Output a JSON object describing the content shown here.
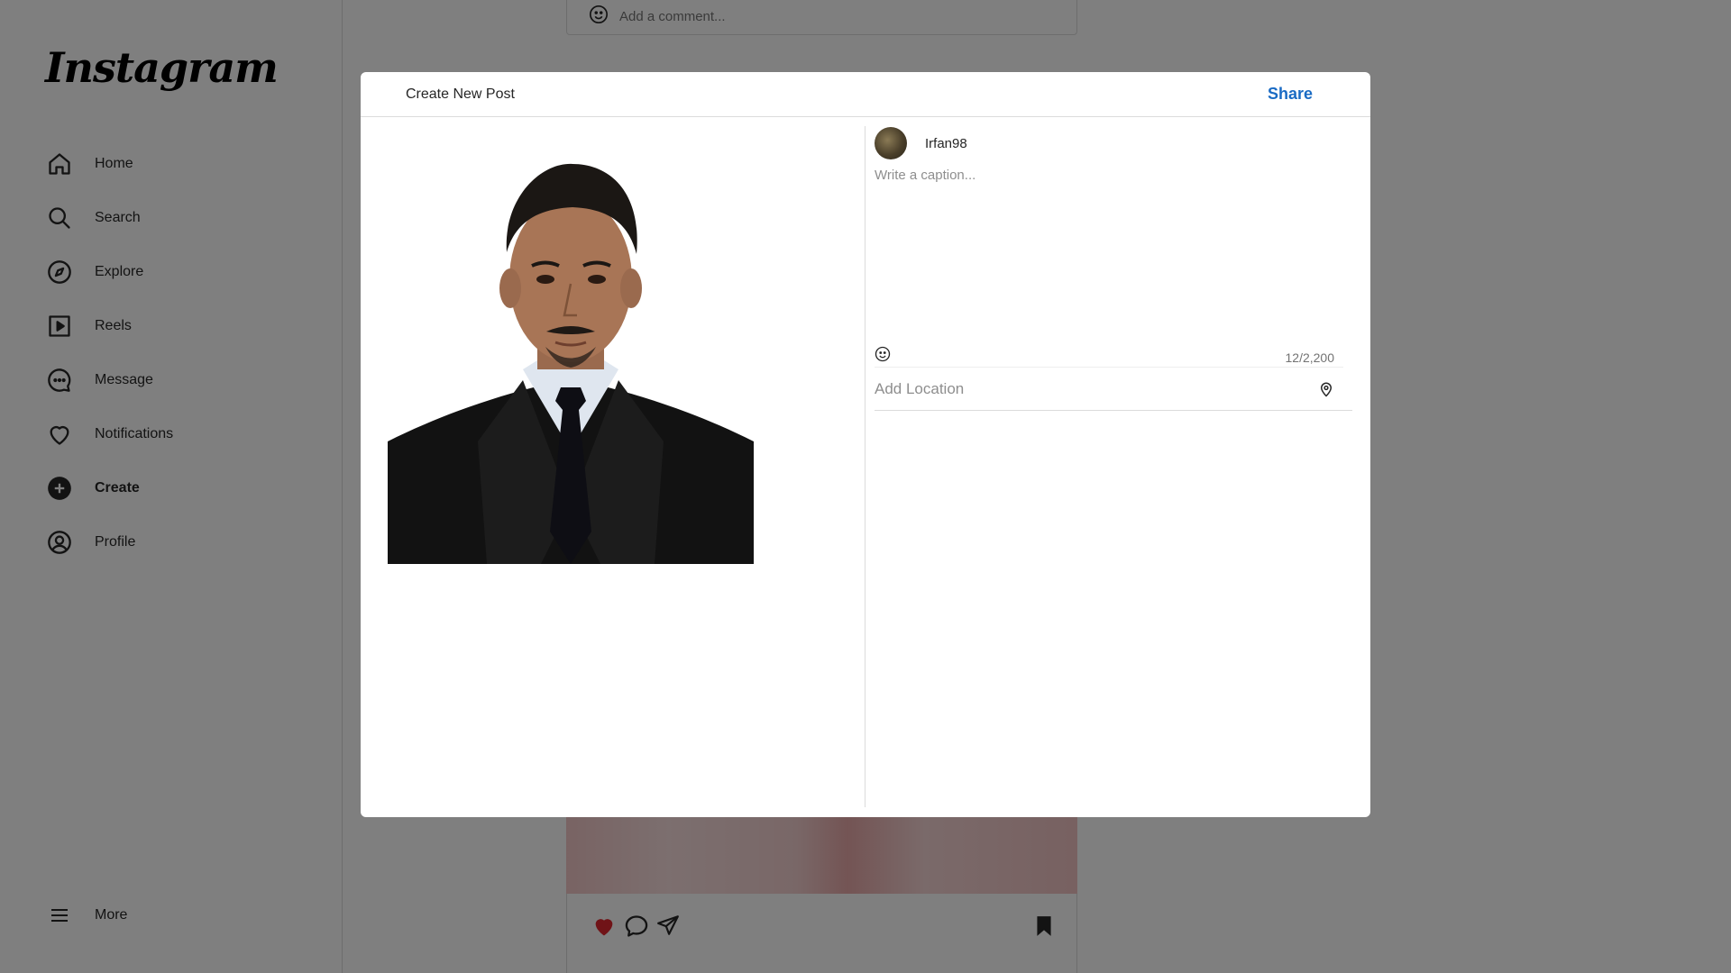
{
  "sidebar": {
    "logo": "Instagram",
    "items": [
      {
        "label": "Home",
        "icon": "home-icon"
      },
      {
        "label": "Search",
        "icon": "search-icon"
      },
      {
        "label": "Explore",
        "icon": "compass-icon"
      },
      {
        "label": "Reels",
        "icon": "reels-icon"
      },
      {
        "label": "Message",
        "icon": "message-icon"
      },
      {
        "label": "Notifications",
        "icon": "heart-icon"
      },
      {
        "label": "Create",
        "icon": "plus-circle-icon",
        "active": true
      },
      {
        "label": "Profile",
        "icon": "profile-icon"
      }
    ],
    "more_label": "More"
  },
  "feed": {
    "comment_placeholder": "Add a comment..."
  },
  "modal": {
    "title": "Create New Post",
    "share_label": "Share",
    "username": "Irfan98",
    "caption_placeholder": "Write a caption...",
    "char_count": "12/2,200",
    "location_placeholder": "Add Location"
  },
  "colors": {
    "share": "#1a6bc4",
    "like": "#e0262e",
    "overlay": "rgba(0,0,0,0.5)"
  }
}
